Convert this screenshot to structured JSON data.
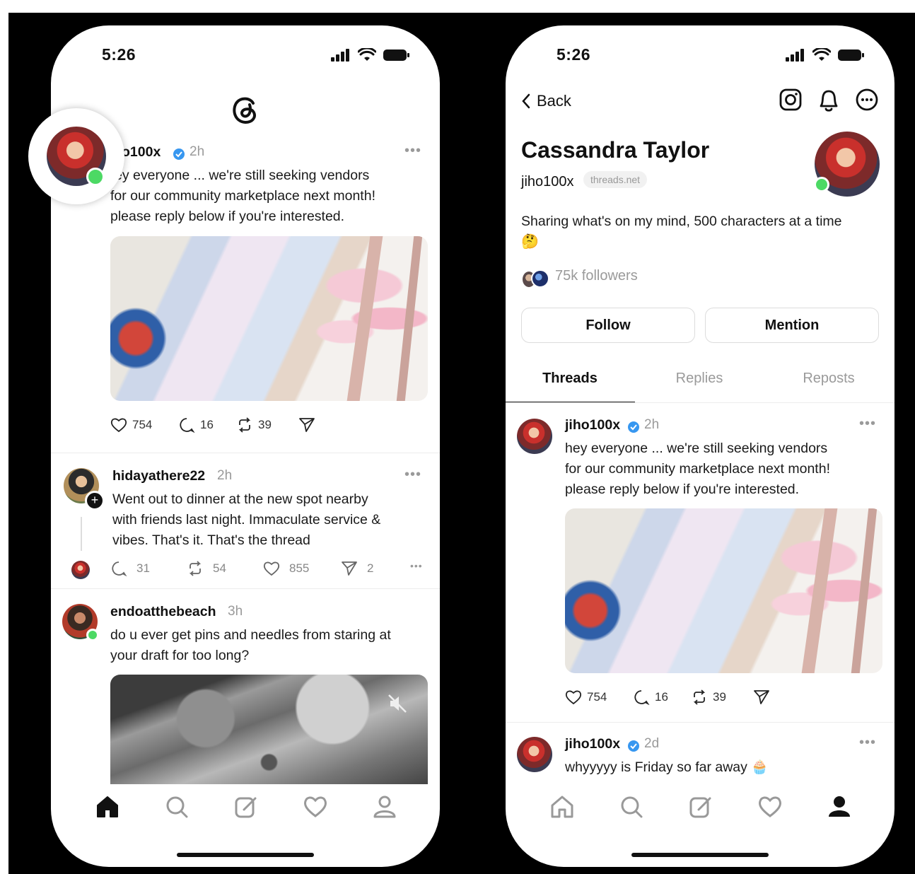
{
  "status_bar": {
    "time": "5:26"
  },
  "left_phone": {
    "posts": [
      {
        "username": "jiho100x",
        "visible_username": "o100x",
        "time": "2h",
        "lines": [
          "ey everyone ... we're still seeking vendors",
          "for our community marketplace next month!",
          "please reply below if you're interested."
        ],
        "likes": "754",
        "comments": "16",
        "reposts": "39"
      },
      {
        "username": "hidayathere22",
        "time": "2h",
        "lines": [
          "Went out to dinner at the new spot nearby",
          "with friends last night. Immaculate service &",
          "vibes. That's it. That's the thread"
        ],
        "comments": "31",
        "reposts": "54",
        "likes": "855",
        "shares": "2"
      },
      {
        "username": "endoatthebeach",
        "time": "3h",
        "lines": [
          "do u ever get pins and needles from staring at",
          "your draft for too long?"
        ]
      }
    ],
    "nav": [
      "home-icon",
      "search-icon",
      "compose-icon",
      "heart-icon",
      "profile-icon"
    ]
  },
  "right_phone": {
    "back_label": "Back",
    "profile": {
      "name": "Cassandra Taylor",
      "handle": "jiho100x",
      "domain_badge": "threads.net",
      "bio": "Sharing what's on my mind, 500 characters at a time",
      "bio_emoji": "🤔",
      "followers": "75k followers"
    },
    "buttons": {
      "follow": "Follow",
      "mention": "Mention"
    },
    "tabs": [
      "Threads",
      "Replies",
      "Reposts"
    ],
    "posts": [
      {
        "username": "jiho100x",
        "time": "2h",
        "lines": [
          "hey everyone ... we're still seeking vendors",
          "for our community marketplace next month!",
          "please reply below if you're interested."
        ],
        "likes": "754",
        "comments": "16",
        "reposts": "39"
      },
      {
        "username": "jiho100x",
        "time": "2d",
        "text": "whyyyyy is Friday so far away",
        "emoji": "🧁"
      }
    ]
  },
  "colors": {
    "verified": "#3797f0",
    "online": "#4cd964",
    "muted": "#9a9a9a"
  }
}
